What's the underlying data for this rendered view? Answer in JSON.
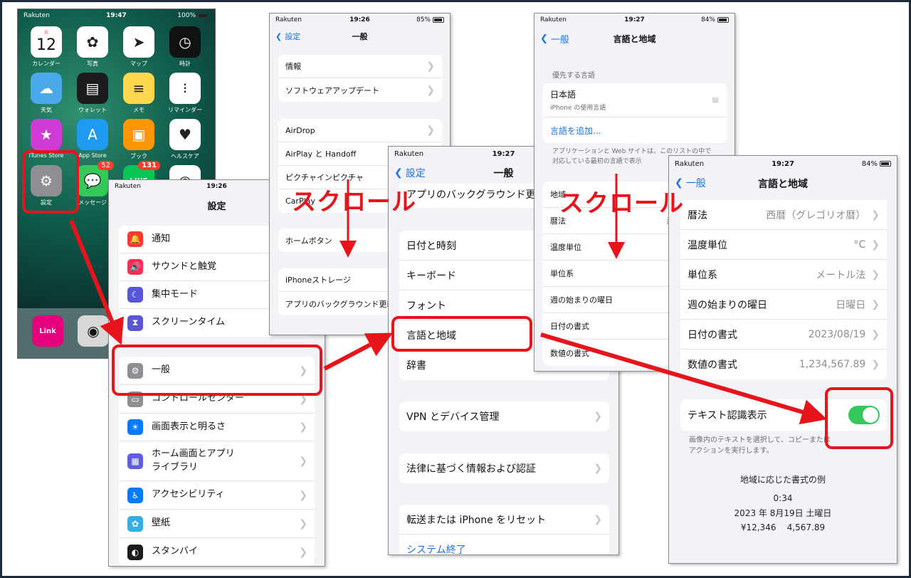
{
  "home": {
    "status": {
      "carrier": "Rakuten",
      "time": "19:47",
      "battery": "100%"
    },
    "apps": [
      {
        "label": "カレンダー",
        "glyph": "12",
        "sub": "火"
      },
      {
        "label": "写真"
      },
      {
        "label": "マップ"
      },
      {
        "label": "時計"
      },
      {
        "label": "天気"
      },
      {
        "label": "ウォレット"
      },
      {
        "label": "メモ"
      },
      {
        "label": "リマインダー"
      },
      {
        "label": "iTunes Store"
      },
      {
        "label": "App Store"
      },
      {
        "label": "ブック"
      },
      {
        "label": "ヘルスケア"
      },
      {
        "label": "設定"
      },
      {
        "label": "メッセージ",
        "badge": "52"
      },
      {
        "label": "LINE",
        "badge": "131"
      },
      {
        "label": "Chrome"
      }
    ],
    "dock": {
      "link_label": "Link"
    }
  },
  "settings": {
    "status": {
      "carrier": "Rakuten",
      "time": "19:26"
    },
    "title": "設定",
    "group1": [
      {
        "label": "通知",
        "icon": "bell-icon",
        "color": "#ff3b30"
      },
      {
        "label": "サウンドと触覚",
        "icon": "speaker-icon",
        "color": "#ff2d55"
      },
      {
        "label": "集中モード",
        "icon": "moon-icon",
        "color": "#5856d6"
      },
      {
        "label": "スクリーンタイム",
        "icon": "hourglass-icon",
        "color": "#5856d6"
      }
    ],
    "group2": [
      {
        "label": "一般",
        "icon": "gear-icon",
        "color": "#8e8e93"
      },
      {
        "label": "コントロールセンター",
        "icon": "switches-icon",
        "color": "#8e8e93"
      },
      {
        "label": "画面表示と明るさ",
        "icon": "sun-icon",
        "color": "#007aff"
      },
      {
        "label": "ホーム画面とアプリ\nライブラリ",
        "icon": "grid-icon",
        "color": "#5e5ce6"
      },
      {
        "label": "アクセシビリティ",
        "icon": "accessibility-icon",
        "color": "#007aff"
      },
      {
        "label": "壁紙",
        "icon": "flower-icon",
        "color": "#32ade6"
      },
      {
        "label": "スタンバイ",
        "icon": "standby-icon",
        "color": "#1c1c1e"
      }
    ]
  },
  "general1": {
    "status": {
      "carrier": "Rakuten",
      "time": "19:26",
      "battery": "85%"
    },
    "back": "設定",
    "title": "一般",
    "group1": [
      "情報",
      "ソフトウェアアップデート"
    ],
    "group2": [
      "AirDrop",
      "AirPlay と Handoff",
      "ピクチャインピクチャ",
      "CarPlay"
    ],
    "group3": [
      "ホームボタン"
    ],
    "group4": [
      "iPhoneストレージ",
      "アプリのバックグラウンド更新"
    ]
  },
  "general2": {
    "status": {
      "carrier": "Rakuten",
      "time": "19:27"
    },
    "back": "設定",
    "title": "一般",
    "top_row": "アプリのバックグラウンド更新",
    "group1": [
      "日付と時刻",
      "キーボード",
      "フォント",
      "言語と地域",
      "辞書"
    ],
    "vpn": "VPN とデバイス管理",
    "legal": "法律に基づく情報および認証",
    "reset": "転送または iPhone をリセット",
    "shutdown": "システム終了"
  },
  "region1": {
    "status": {
      "carrier": "Rakuten",
      "time": "19:27",
      "battery": "84%"
    },
    "back": "一般",
    "title": "言語と地域",
    "pref_header": "優先する言語",
    "lang_name": "日本語",
    "lang_sub": "iPhone の使用言語",
    "add_lang": "言語を追加...",
    "footer": "アプリケーションと Web サイトは、このリストの中で対応している最初の言語で表示",
    "rows": [
      {
        "label": "地域",
        "value": ""
      },
      {
        "label": "暦法",
        "value": "西暦（グレ"
      },
      {
        "label": "温度単位",
        "value": ""
      },
      {
        "label": "単位系",
        "value": "メ"
      },
      {
        "label": "週の始まりの曜日",
        "value": ""
      },
      {
        "label": "日付の書式",
        "value": "20"
      },
      {
        "label": "数値の書式",
        "value": "1,23"
      }
    ]
  },
  "region2": {
    "status": {
      "carrier": "Rakuten",
      "time": "19:27",
      "battery": "84%"
    },
    "back": "一般",
    "title": "言語と地域",
    "rows": [
      {
        "label": "暦法",
        "value": "西暦（グレゴリオ暦）"
      },
      {
        "label": "温度単位",
        "value": "°C"
      },
      {
        "label": "単位系",
        "value": "メートル法"
      },
      {
        "label": "週の始まりの曜日",
        "value": "日曜日"
      },
      {
        "label": "日付の書式",
        "value": "2023/08/19"
      },
      {
        "label": "数値の書式",
        "value": "1,234,567.89"
      }
    ],
    "live_text": "テキスト認識表示",
    "live_footer": "画像内のテキストを選択して、コピーまたは\nアクションを実行します。",
    "example_title": "地域に応じた書式の例",
    "example_time": "0:34",
    "example_date": "2023 年 8月19日 土曜日",
    "example_numbers": "¥12,346    4,567.89"
  },
  "annotations": {
    "scroll1": "スクロール",
    "scroll2": "スクロール"
  },
  "colors": {
    "highlight": "#e8141b",
    "link": "#1a73e8",
    "toggle": "#34c759"
  }
}
